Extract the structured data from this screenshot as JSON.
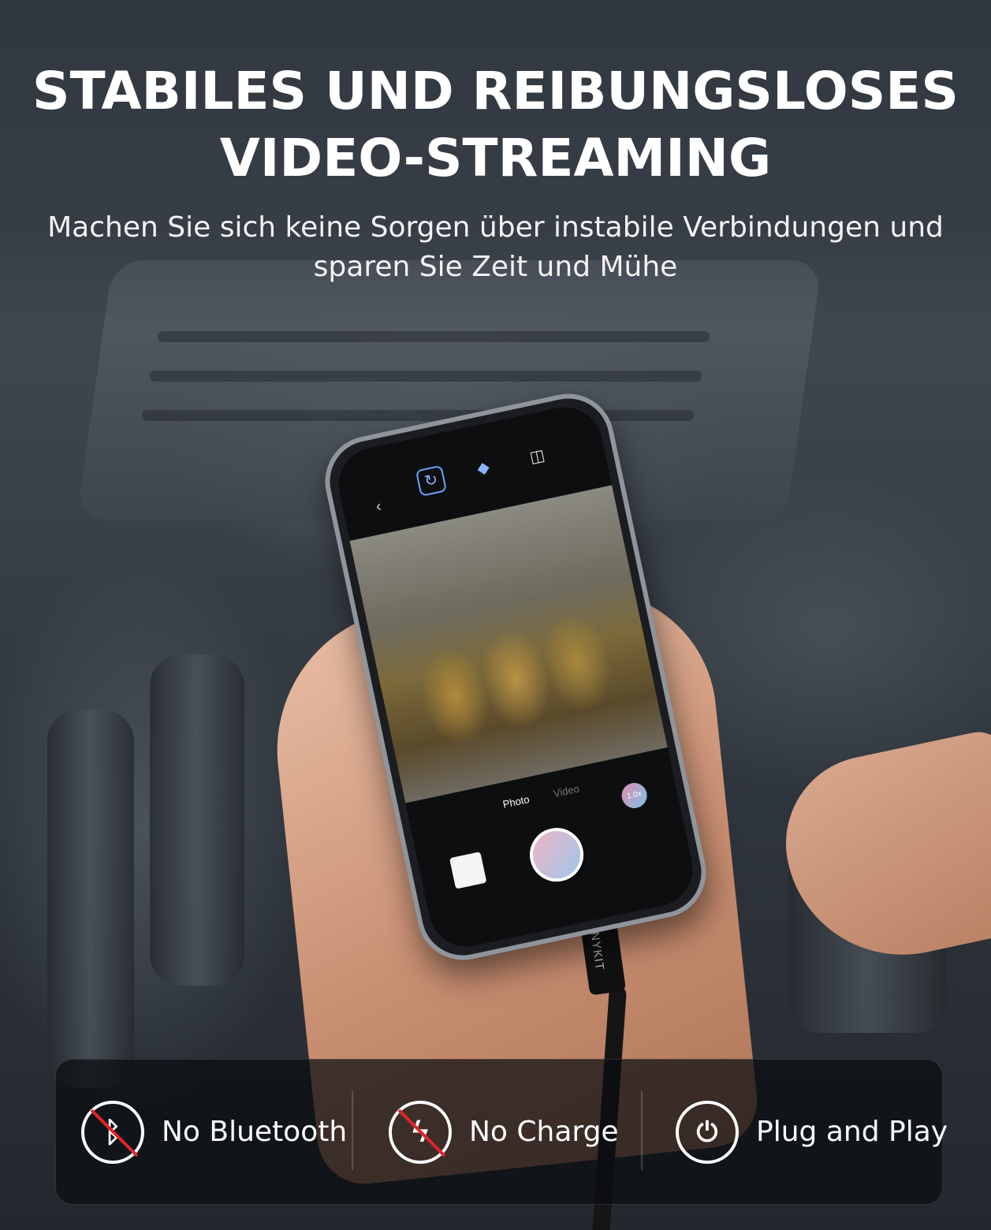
{
  "headline": {
    "line1": "STABILES UND REIBUNGSLOSES",
    "line2": "VIDEO-STREAMING"
  },
  "subheadline": {
    "line1": "Machen Sie sich keine Sorgen über instabile Verbindungen und",
    "line2": "sparen Sie Zeit und Mühe"
  },
  "phone_app": {
    "back_icon": "chevron-left-icon",
    "top_icons": [
      "rotate-icon",
      "cube-icon",
      "mirror-icon"
    ],
    "modes": [
      "Photo",
      "Video"
    ],
    "zoom_label": "1.0x"
  },
  "cable_brand": "ANYKIT",
  "features": [
    {
      "label": "No Bluetooth",
      "icon": "bluetooth-crossed-icon"
    },
    {
      "label": "No Charge",
      "icon": "lightning-crossed-icon"
    },
    {
      "label": "Plug and Play",
      "icon": "plug-icon"
    }
  ],
  "colors": {
    "crossed_red": "#e0252b",
    "text": "#ffffff"
  }
}
